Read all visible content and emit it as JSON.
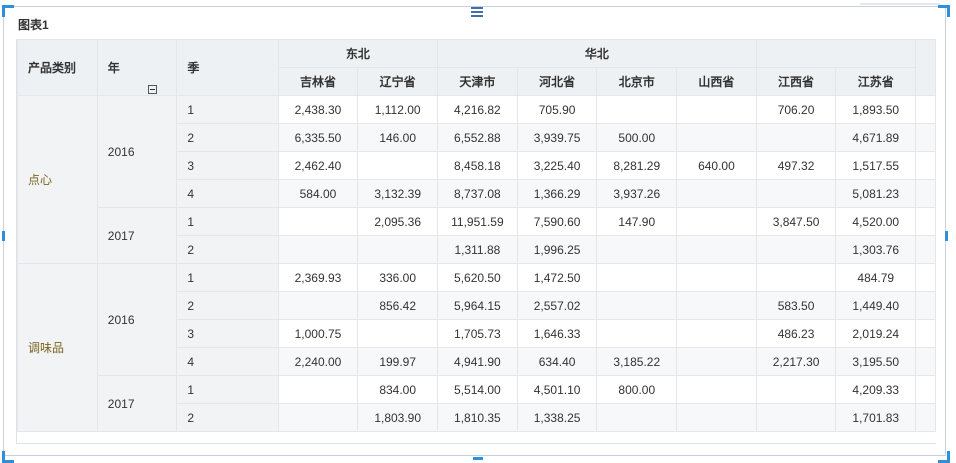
{
  "widget": {
    "title": "图表1"
  },
  "table": {
    "row_headers": [
      "产品类别",
      "年",
      "季"
    ],
    "regions": [
      {
        "name": "东北",
        "provinces": [
          "吉林省",
          "辽宁省"
        ]
      },
      {
        "name": "华北",
        "provinces": [
          "天津市",
          "河北省",
          "北京市",
          "山西省"
        ]
      },
      {
        "name": "",
        "provinces": [
          "江西省",
          "江苏省"
        ]
      }
    ],
    "categories": [
      {
        "name": "点心",
        "years": [
          {
            "year": "2016",
            "quarters": [
              {
                "q": "1",
                "values": [
                  "2,438.30",
                  "1,112.00",
                  "4,216.82",
                  "705.90",
                  "",
                  "",
                  "706.20",
                  "1,893.50"
                ]
              },
              {
                "q": "2",
                "values": [
                  "6,335.50",
                  "146.00",
                  "6,552.88",
                  "3,939.75",
                  "500.00",
                  "",
                  "",
                  "4,671.89"
                ]
              },
              {
                "q": "3",
                "values": [
                  "2,462.40",
                  "",
                  "8,458.18",
                  "3,225.40",
                  "8,281.29",
                  "640.00",
                  "497.32",
                  "1,517.55"
                ]
              },
              {
                "q": "4",
                "values": [
                  "584.00",
                  "3,132.39",
                  "8,737.08",
                  "1,366.29",
                  "3,937.26",
                  "",
                  "",
                  "5,081.23"
                ]
              }
            ]
          },
          {
            "year": "2017",
            "quarters": [
              {
                "q": "1",
                "values": [
                  "",
                  "2,095.36",
                  "11,951.59",
                  "7,590.60",
                  "147.90",
                  "",
                  "3,847.50",
                  "4,520.00"
                ]
              },
              {
                "q": "2",
                "values": [
                  "",
                  "",
                  "1,311.88",
                  "1,996.25",
                  "",
                  "",
                  "",
                  "1,303.76"
                ]
              }
            ]
          }
        ]
      },
      {
        "name": "调味品",
        "years": [
          {
            "year": "2016",
            "quarters": [
              {
                "q": "1",
                "values": [
                  "2,369.93",
                  "336.00",
                  "5,620.50",
                  "1,472.50",
                  "",
                  "",
                  "",
                  "484.79"
                ]
              },
              {
                "q": "2",
                "values": [
                  "",
                  "856.42",
                  "5,964.15",
                  "2,557.02",
                  "",
                  "",
                  "583.50",
                  "1,449.40"
                ]
              },
              {
                "q": "3",
                "values": [
                  "1,000.75",
                  "",
                  "1,705.73",
                  "1,646.33",
                  "",
                  "",
                  "486.23",
                  "2,019.24"
                ]
              },
              {
                "q": "4",
                "values": [
                  "2,240.00",
                  "199.97",
                  "4,941.90",
                  "634.40",
                  "3,185.22",
                  "",
                  "2,217.30",
                  "3,195.50"
                ]
              }
            ]
          },
          {
            "year": "2017",
            "quarters": [
              {
                "q": "1",
                "values": [
                  "",
                  "834.00",
                  "5,514.00",
                  "4,501.10",
                  "800.00",
                  "",
                  "",
                  "4,209.33"
                ]
              },
              {
                "q": "2",
                "values": [
                  "",
                  "1,803.90",
                  "1,810.35",
                  "1,338.25",
                  "",
                  "",
                  "",
                  "1,701.83"
                ]
              }
            ]
          }
        ]
      }
    ]
  },
  "icons": {
    "collapse": "minus-square-icon",
    "drag": "drag-handle-icon"
  }
}
